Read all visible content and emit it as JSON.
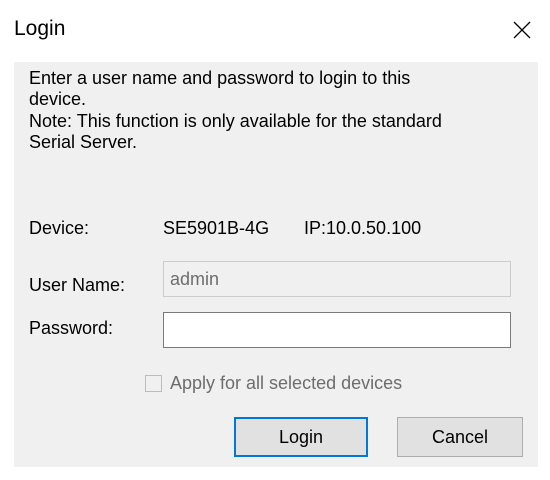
{
  "window": {
    "title": "Login",
    "close_icon": "close-icon"
  },
  "message": {
    "line1": "Enter a user name and password to login to this",
    "line2": "device.",
    "line3": "Note: This function is only available for the standard",
    "line4": "Serial Server."
  },
  "device": {
    "label": "Device:",
    "name": "SE5901B-4G",
    "ip": "IP:10.0.50.100"
  },
  "username": {
    "label": "User Name:",
    "value": "admin"
  },
  "password": {
    "label": "Password:",
    "value": ""
  },
  "apply_all": {
    "label": "Apply for all selected devices",
    "checked": false,
    "enabled": false
  },
  "buttons": {
    "login": "Login",
    "cancel": "Cancel"
  },
  "colors": {
    "dialog_bg": "#f0f0f0",
    "title_bg": "#ffffff",
    "default_button_border": "#0078d7",
    "disabled_text": "#6d6d6d"
  }
}
